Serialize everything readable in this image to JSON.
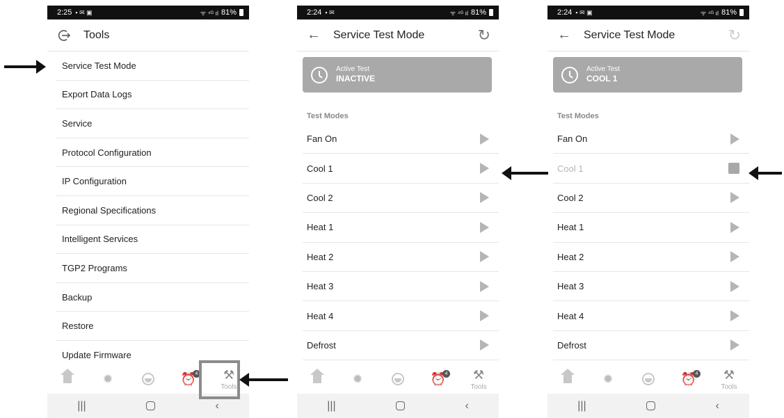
{
  "screen1": {
    "status": {
      "time": "2:25",
      "left_icons": "▪ ✉ ▣",
      "signal": "ᯤ ⁴ᴳ ıl",
      "battery": "81%"
    },
    "header": {
      "title": "Tools"
    },
    "menu": [
      "Service Test Mode",
      "Export Data Logs",
      "Service",
      "Protocol Configuration",
      "IP Configuration",
      "Regional Specifications",
      "Intelligent Services",
      "TGP2 Programs",
      "Backup",
      "Restore",
      "Update Firmware"
    ]
  },
  "screen2": {
    "status": {
      "time": "2:24",
      "left_icons": "▪ ✉",
      "signal": "ᯤ ⁴ᴳ ıl",
      "battery": "81%"
    },
    "header": {
      "title": "Service Test Mode"
    },
    "active_test": {
      "label": "Active Test",
      "value": "INACTIVE"
    },
    "section_title": "Test Modes",
    "modes": [
      "Fan On",
      "Cool 1",
      "Cool 2",
      "Heat 1",
      "Heat 2",
      "Heat 3",
      "Heat 4",
      "Defrost"
    ]
  },
  "screen3": {
    "status": {
      "time": "2:24",
      "left_icons": "▪ ✉ ▣",
      "signal": "ᯤ ⁴ᴳ ıl",
      "battery": "81%"
    },
    "header": {
      "title": "Service Test Mode"
    },
    "active_test": {
      "label": "Active Test",
      "value": "COOL 1"
    },
    "section_title": "Test Modes",
    "modes": [
      "Fan On",
      "Cool 1",
      "Cool 2",
      "Heat 1",
      "Heat 2",
      "Heat 3",
      "Heat 4",
      "Defrost"
    ],
    "running_mode": "Cool 1"
  },
  "tabbar": {
    "tools_label": "Tools",
    "alarm_badge": "4"
  },
  "colors": {
    "card_bg": "#a9a9a9",
    "arrow": "#111111",
    "highlight_box": "#8c8c8c"
  }
}
